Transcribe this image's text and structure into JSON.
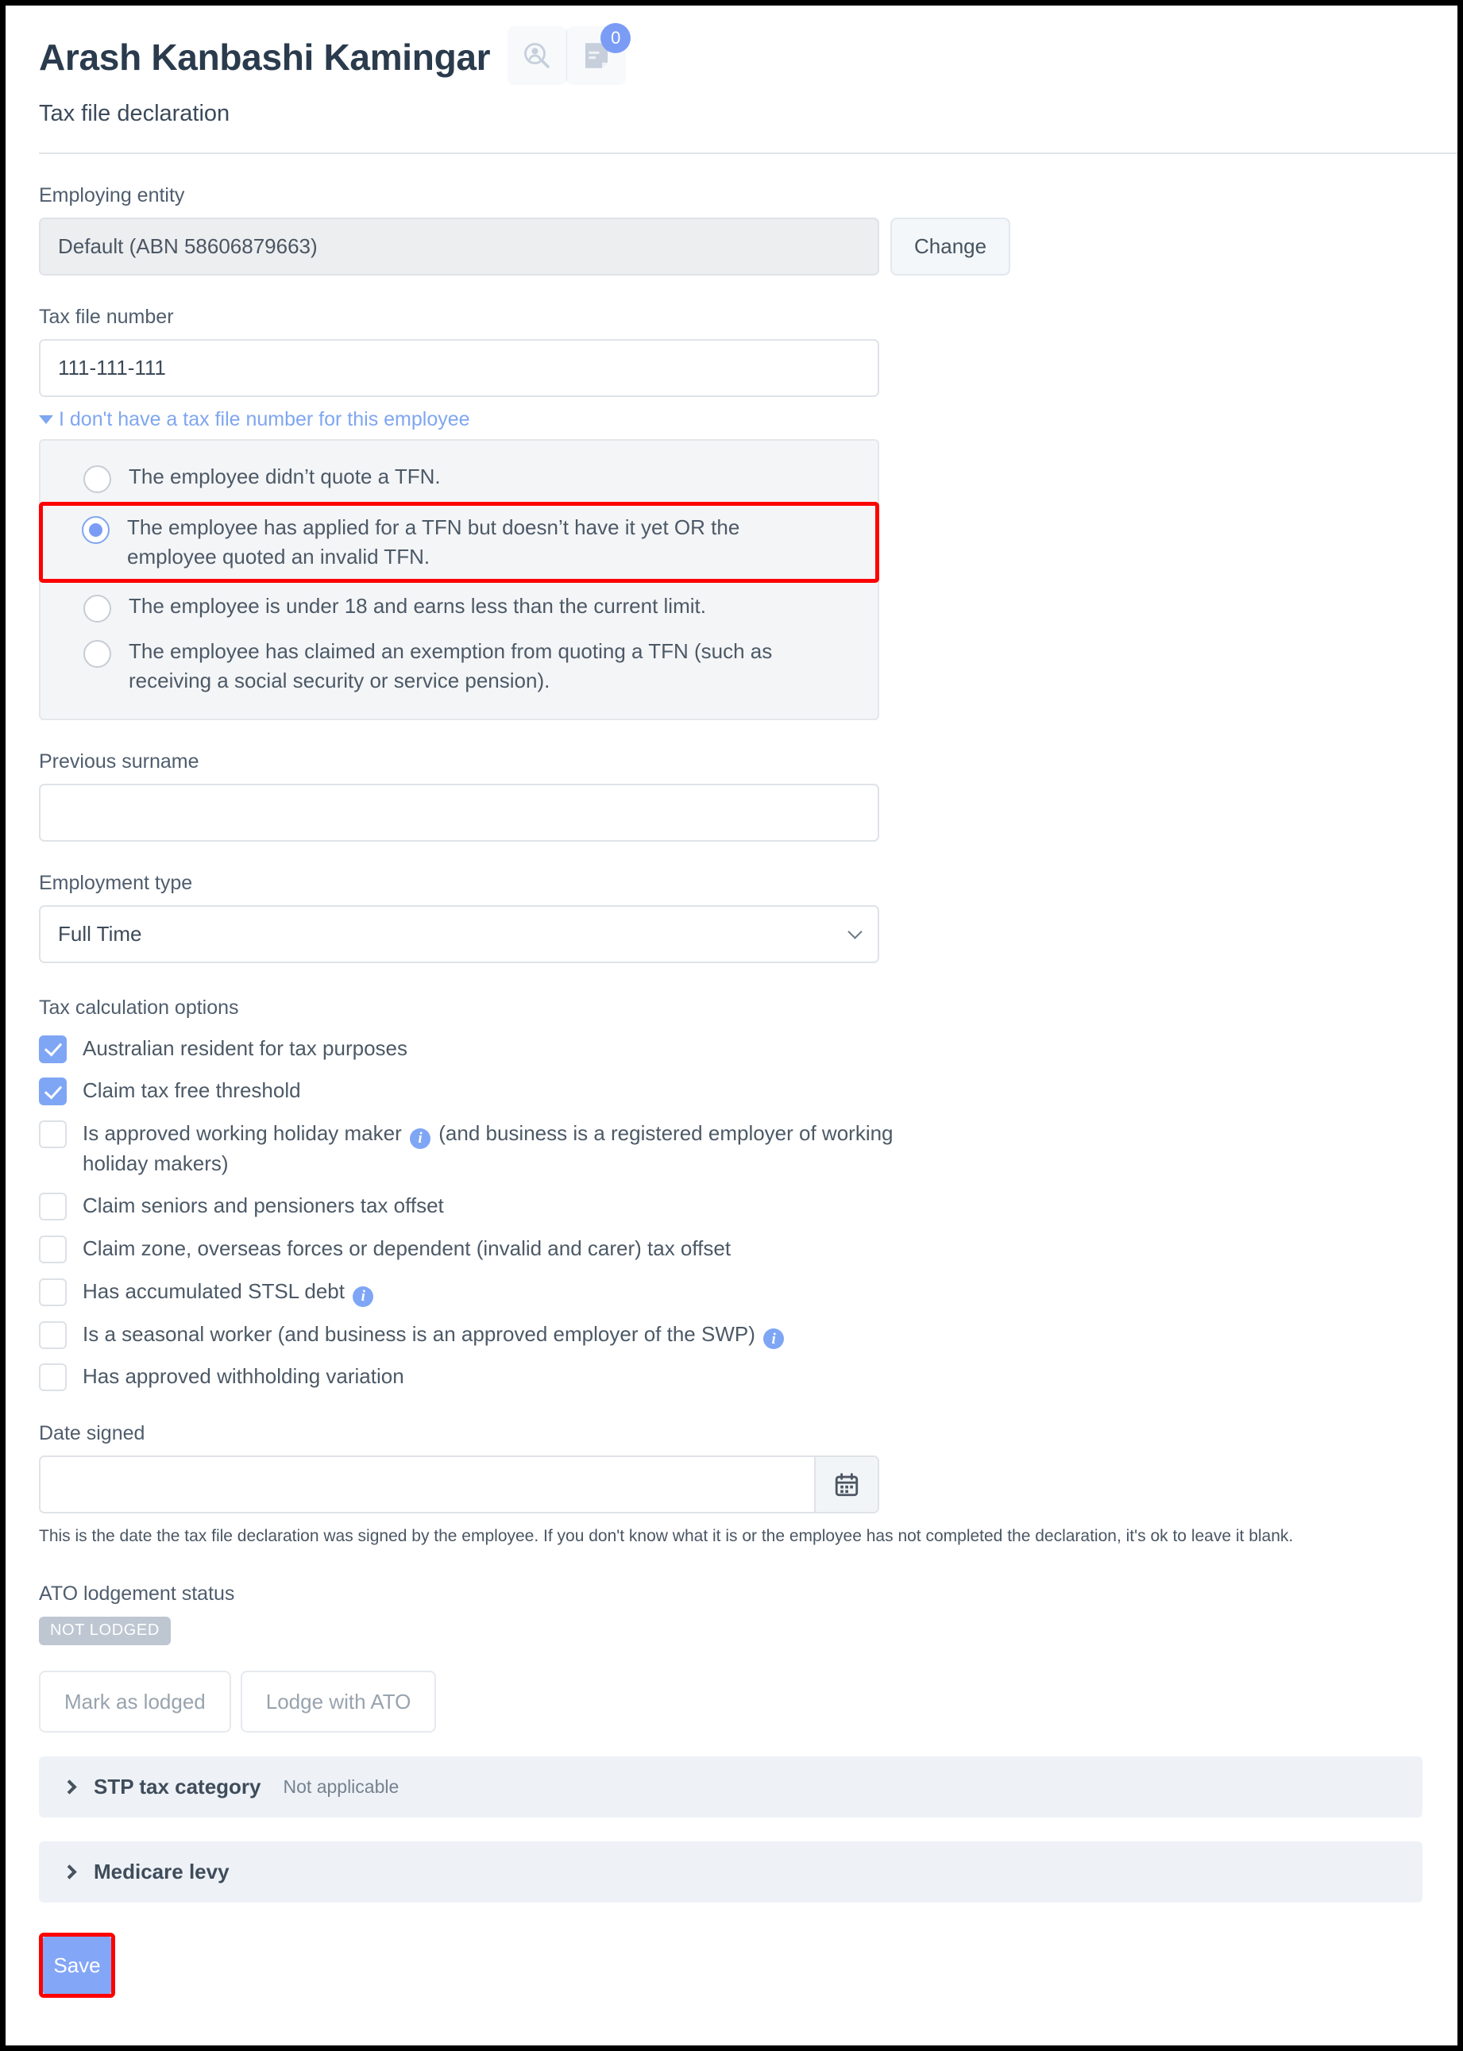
{
  "header": {
    "title": "Arash Kanbashi Kamingar",
    "subtitle": "Tax file declaration",
    "search_icon": "person-search-icon",
    "doc_icon": "document-edit-icon",
    "doc_badge_count": "0"
  },
  "employing_entity": {
    "label": "Employing entity",
    "value": "Default (ABN 58606879663)",
    "change_label": "Change"
  },
  "tax_file_number": {
    "label": "Tax file number",
    "value": "111-111-111",
    "toggle_link": "I don't have a tax file number for this employee",
    "options": [
      {
        "label": "The employee didn’t quote a TFN.",
        "checked": false,
        "highlighted": false
      },
      {
        "label": "The employee has applied for a TFN but doesn’t have it yet OR the employee quoted an invalid TFN.",
        "checked": true,
        "highlighted": true
      },
      {
        "label": "The employee is under 18 and earns less than the current limit.",
        "checked": false,
        "highlighted": false
      },
      {
        "label": "The employee has claimed an exemption from quoting a TFN (such as receiving a social security or service pension).",
        "checked": false,
        "highlighted": false
      }
    ]
  },
  "previous_surname": {
    "label": "Previous surname",
    "value": ""
  },
  "employment_type": {
    "label": "Employment type",
    "value": "Full Time"
  },
  "tax_calculation_options": {
    "label": "Tax calculation options",
    "items": [
      {
        "label": "Australian resident for tax purposes",
        "checked": true,
        "info": false
      },
      {
        "label": "Claim tax free threshold",
        "checked": true,
        "info": false
      },
      {
        "label_before": "Is approved working holiday maker",
        "label_after": "(and business is a registered employer of working holiday makers)",
        "checked": false,
        "info": true
      },
      {
        "label": "Claim seniors and pensioners tax offset",
        "checked": false,
        "info": false
      },
      {
        "label": "Claim zone, overseas forces or dependent (invalid and carer) tax offset",
        "checked": false,
        "info": false
      },
      {
        "label_before": "Has accumulated STSL debt",
        "label_after": "",
        "checked": false,
        "info": true
      },
      {
        "label_before": "Is a seasonal worker (and business is an approved employer of the SWP)",
        "label_after": "",
        "checked": false,
        "info": true
      },
      {
        "label": "Has approved withholding variation",
        "checked": false,
        "info": false
      }
    ]
  },
  "date_signed": {
    "label": "Date signed",
    "value": "",
    "calendar_icon": "calendar-icon",
    "helper": "This is the date the tax file declaration was signed by the employee. If you don't know what it is or the employee has not completed the declaration, it's ok to leave it blank."
  },
  "ato_lodgement": {
    "label": "ATO lodgement status",
    "status": "NOT LODGED",
    "mark_lodged_label": "Mark as lodged",
    "lodge_with_ato_label": "Lodge with ATO"
  },
  "accordions": [
    {
      "title": "STP tax category",
      "value": "Not applicable"
    },
    {
      "title": "Medicare levy",
      "value": ""
    }
  ],
  "save": {
    "label": "Save"
  },
  "colors": {
    "accent_blue": "#7fa6f5",
    "highlight_red": "#fe0000",
    "badge_gray": "#bec6d1",
    "panel_gray": "#f4f5f7",
    "accordion_bg": "#eef2f7"
  }
}
